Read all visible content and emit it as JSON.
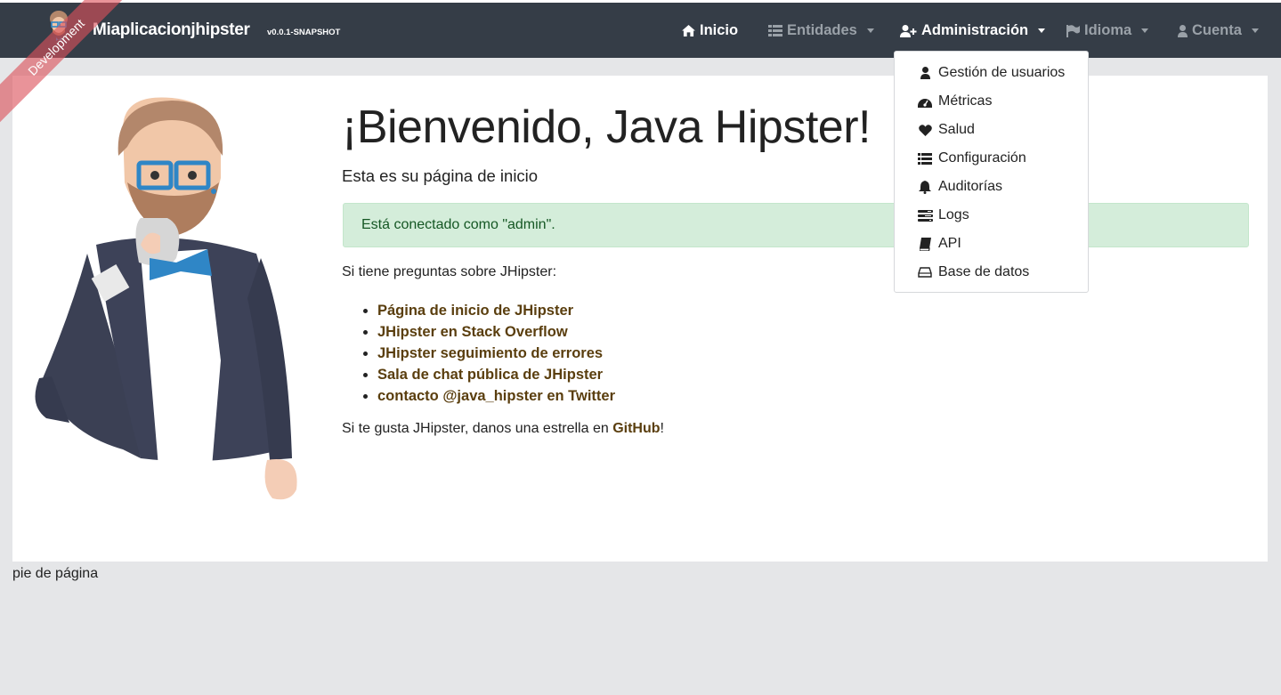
{
  "brand": {
    "title": "Miaplicacionjhipster",
    "version": "v0.0.1-SNAPSHOT",
    "ribbon": "Development"
  },
  "nav": {
    "home": "Inicio",
    "entities": "Entidades",
    "admin": "Administración",
    "language": "Idioma",
    "account": "Cuenta"
  },
  "admin_menu": [
    {
      "label": "Gestión de usuarios",
      "icon": "user-icon"
    },
    {
      "label": "Métricas",
      "icon": "tachometer-icon"
    },
    {
      "label": "Salud",
      "icon": "heart-icon"
    },
    {
      "label": "Configuración",
      "icon": "list-icon"
    },
    {
      "label": "Auditorías",
      "icon": "bell-icon"
    },
    {
      "label": "Logs",
      "icon": "tasks-icon"
    },
    {
      "label": "API",
      "icon": "book-icon"
    },
    {
      "label": "Base de datos",
      "icon": "hdd-icon"
    }
  ],
  "home": {
    "title": "¡Bienvenido, Java Hipster!",
    "subtitle": "Esta es su página de inicio",
    "alert": "Está conectado como \"admin\".",
    "question": "Si tiene preguntas sobre JHipster:",
    "links": [
      "Página de inicio de JHipster",
      "JHipster en Stack Overflow",
      "JHipster seguimiento de errores",
      "Sala de chat pública de JHipster",
      "contacto @java_hipster en Twitter"
    ],
    "star_prefix": "Si te gusta JHipster, danos una estrella en ",
    "star_link": "GitHub",
    "star_suffix": "!"
  },
  "footer": "pie de página",
  "colors": {
    "navbar": "#353d47",
    "link": "#5a3e0e",
    "alert_bg": "#d4edda",
    "alert_text": "#155724",
    "page_bg": "#e5e6e8"
  }
}
